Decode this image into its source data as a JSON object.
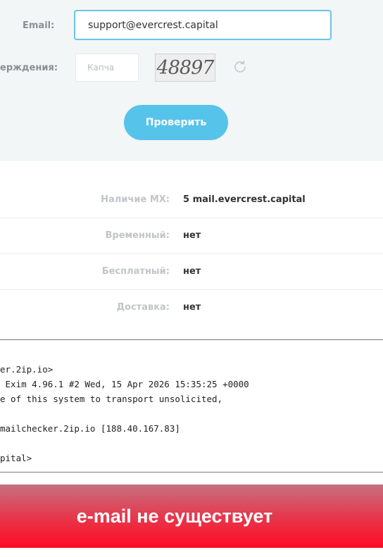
{
  "form": {
    "email_label": "Email:",
    "email_value": "support@evercrest.capital",
    "captcha_label": "ерждения:",
    "captcha_placeholder": "Капча",
    "captcha_code": "48897",
    "check_button": "Проверить"
  },
  "results": [
    {
      "label": "Наличие MX:",
      "value": "5 mail.evercrest.capital"
    },
    {
      "label": "Временный:",
      "value": "нет"
    },
    {
      "label": "Бесплатный:",
      "value": "нет"
    },
    {
      "label": "Доставка:",
      "value": "нет"
    }
  ],
  "log": [
    "er.2ip.io>",
    " Exim 4.96.1 #2 Wed, 15 Apr 2026 15:35:25 +0000",
    "e of this system to transport unsolicited,",
    "",
    "mailchecker.2ip.io [188.40.167.83]",
    "",
    "pital>"
  ],
  "banner": "e-mail не существует",
  "colors": {
    "accent": "#56c3ea",
    "input_border": "#6cc3e3",
    "banner_top": "#c57181",
    "banner_bottom": "#ff0a24"
  }
}
